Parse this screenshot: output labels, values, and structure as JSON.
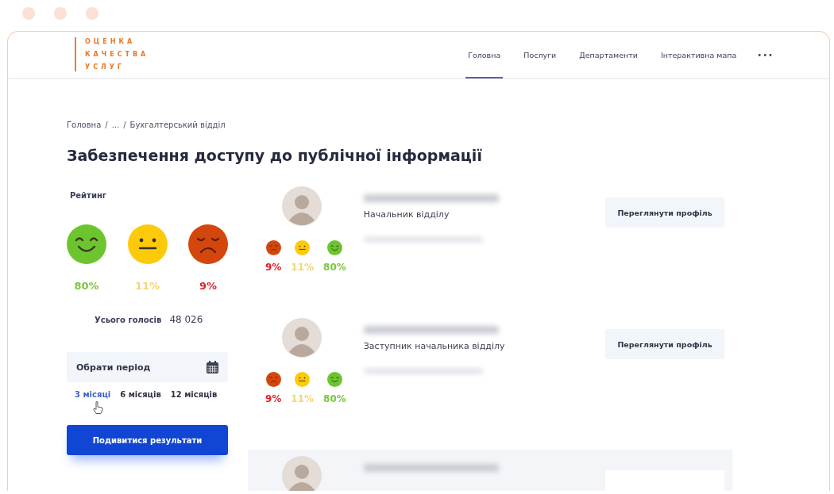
{
  "logo": {
    "lines": [
      "ОЦЕНКА",
      "КАЧЕСТВА",
      "УСЛУГ"
    ]
  },
  "nav": {
    "items": [
      {
        "label": "Головна",
        "selected": true
      },
      {
        "label": "Послуги",
        "selected": false
      },
      {
        "label": "Департаменти",
        "selected": false
      },
      {
        "label": "Інтерактивна мапа",
        "selected": false
      }
    ],
    "more": "•••"
  },
  "breadcrumb": {
    "items": [
      "Головна",
      "...",
      "Бухгалтерський відділ"
    ],
    "separator": "/"
  },
  "title": "Забезпечення доступу до публічної інформації",
  "rating": {
    "label": "Рейтинг",
    "faces": [
      {
        "kind": "positive",
        "percent": "80%"
      },
      {
        "kind": "neutral",
        "percent": "11%"
      },
      {
        "kind": "negative",
        "percent": "9%"
      }
    ],
    "total_label": "Усього голосів",
    "total_value": "48 026"
  },
  "period": {
    "label": "Обрати період",
    "options": [
      {
        "label": "3 місяці",
        "selected": true
      },
      {
        "label": "6 місяців",
        "selected": false
      },
      {
        "label": "12 місяців",
        "selected": false
      }
    ]
  },
  "results_button": "Подивитися результати",
  "employees": [
    {
      "highlighted": false,
      "position": "Начальник відділу",
      "ratings": [
        {
          "kind": "negative",
          "percent": "9%"
        },
        {
          "kind": "neutral",
          "percent": "11%"
        },
        {
          "kind": "positive",
          "percent": "80%"
        }
      ],
      "button": "Переглянути профіль"
    },
    {
      "highlighted": false,
      "position": "Заступник начальника відділу",
      "ratings": [
        {
          "kind": "negative",
          "percent": "9%"
        },
        {
          "kind": "neutral",
          "percent": "11%"
        },
        {
          "kind": "positive",
          "percent": "80%"
        }
      ],
      "button": "Переглянути профіль"
    },
    {
      "highlighted": true
    }
  ]
}
